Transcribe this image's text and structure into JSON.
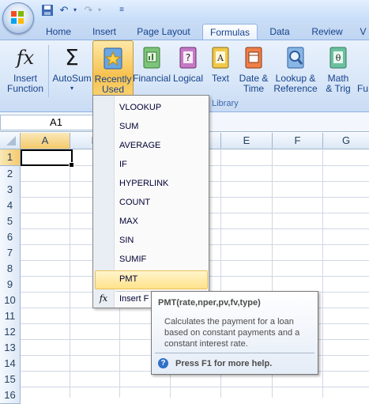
{
  "quick_access": {
    "save_icon": "save-icon",
    "undo_icon": "undo-icon",
    "redo_icon": "redo-icon",
    "customize_icon": "customize-icon"
  },
  "tabs": [
    {
      "label": "Home"
    },
    {
      "label": "Insert"
    },
    {
      "label": "Page Layout"
    },
    {
      "label": "Formulas",
      "active": true
    },
    {
      "label": "Data"
    },
    {
      "label": "Review"
    },
    {
      "label": "V"
    }
  ],
  "ribbon": {
    "insert_function": "Insert\nFunction",
    "autosum": "AutoSum",
    "recently_used": "Recently\nUsed",
    "financial": "Financial",
    "logical": "Logical",
    "text": "Text",
    "date_time": "Date &\nTime",
    "lookup_reference": "Lookup &\nReference",
    "math_trig": "Math\n& Trig",
    "more": "Fu",
    "group_label": "Library"
  },
  "name_box": "A1",
  "columns": [
    "A",
    "B",
    "C",
    "D",
    "E",
    "F",
    "G"
  ],
  "rows": [
    "1",
    "2",
    "3",
    "4",
    "5",
    "6",
    "7",
    "8",
    "9",
    "10",
    "11",
    "12",
    "13",
    "14",
    "15",
    "16"
  ],
  "menu": {
    "items": [
      "VLOOKUP",
      "SUM",
      "AVERAGE",
      "IF",
      "HYPERLINK",
      "COUNT",
      "MAX",
      "SIN",
      "SUMIF",
      "PMT"
    ],
    "insert_function": "Insert F"
  },
  "tooltip": {
    "title": "PMT(rate,nper,pv,fv,type)",
    "description": "Calculates the payment for a loan based on constant payments and a constant interest rate.",
    "help": "Press F1 for more help."
  },
  "colors": {
    "accent": "#15428b",
    "highlight": "#ffe28a"
  }
}
